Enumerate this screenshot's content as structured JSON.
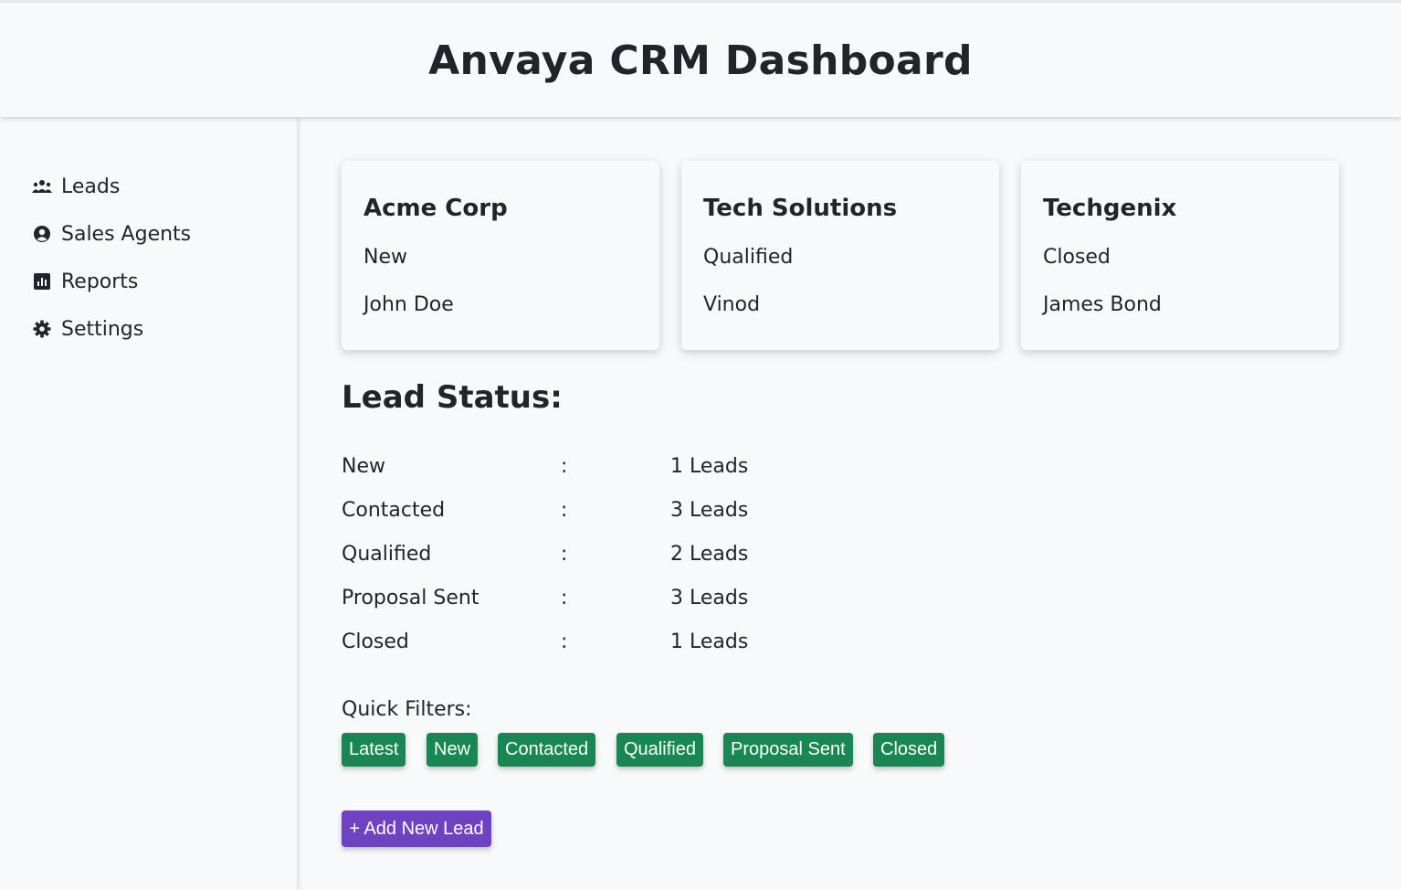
{
  "header": {
    "title": "Anvaya CRM Dashboard"
  },
  "sidebar": {
    "items": [
      {
        "label": "Leads",
        "icon": "users-icon"
      },
      {
        "label": "Sales Agents",
        "icon": "user-circle-icon"
      },
      {
        "label": "Reports",
        "icon": "chart-icon"
      },
      {
        "label": "Settings",
        "icon": "gear-icon"
      }
    ]
  },
  "leads": [
    {
      "name": "Acme Corp",
      "status": "New",
      "agent": "John Doe"
    },
    {
      "name": "Tech Solutions",
      "status": "Qualified",
      "agent": "Vinod"
    },
    {
      "name": "Techgenix",
      "status": "Closed",
      "agent": "James Bond"
    }
  ],
  "lead_status": {
    "title": "Lead Status:",
    "separator": ":",
    "rows": [
      {
        "label": "New",
        "count": "1 Leads"
      },
      {
        "label": "Contacted",
        "count": "3 Leads"
      },
      {
        "label": "Qualified",
        "count": "2 Leads"
      },
      {
        "label": "Proposal Sent",
        "count": "3 Leads"
      },
      {
        "label": "Closed",
        "count": "1 Leads"
      }
    ]
  },
  "filters": {
    "label": "Quick Filters:",
    "buttons": [
      "Latest",
      "New",
      "Contacted",
      "Qualified",
      "Proposal Sent",
      "Closed"
    ]
  },
  "actions": {
    "add_lead": "+ Add New Lead"
  },
  "colors": {
    "background": "#f8f9fa",
    "filter_button": "#198754",
    "add_button": "#6f42c1",
    "text": "#212529"
  }
}
